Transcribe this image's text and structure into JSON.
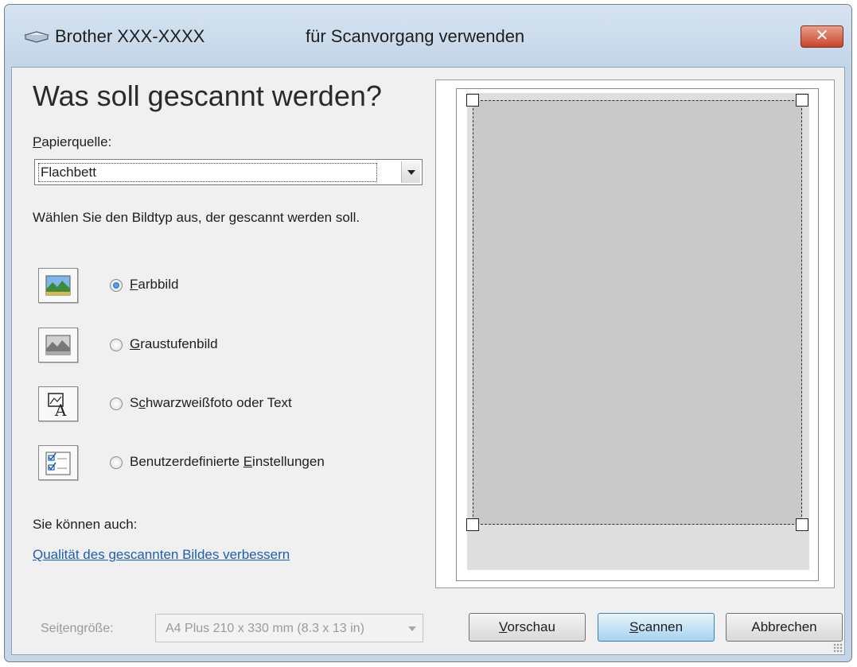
{
  "window": {
    "title_app": "Brother XXX-XXXX",
    "title_rest": "für Scanvorgang verwenden",
    "close_glyph": "✕"
  },
  "main": {
    "heading": "Was soll gescannt werden?",
    "paper_source_label_u": "P",
    "paper_source_label_rest": "apierquelle:",
    "paper_source_value": "Flachbett",
    "description": "Wählen Sie den Bildtyp aus, der gescannt werden soll.",
    "image_types": [
      {
        "label_pre": "",
        "label_u": "F",
        "label_post": "arbbild",
        "checked": true,
        "icon": "color-photo-icon"
      },
      {
        "label_pre": "",
        "label_u": "G",
        "label_post": "raustufenbild",
        "checked": false,
        "icon": "grayscale-photo-icon"
      },
      {
        "label_pre": "S",
        "label_u": "c",
        "label_post": "hwarzweißfoto oder Text",
        "checked": false,
        "icon": "bw-text-icon"
      },
      {
        "label_pre": "Benutzerdefinierte ",
        "label_u": "E",
        "label_post": "instellungen",
        "checked": false,
        "icon": "custom-settings-icon"
      }
    ],
    "also_label": "Sie können auch:",
    "improve_link": "Qualität des gescannten Bildes verbessern"
  },
  "footer": {
    "page_size_label_pre": "Sei",
    "page_size_label_u": "t",
    "page_size_label_post": "engröße:",
    "page_size_value": "A4 Plus 210 x 330 mm (8.3 x 13 in)",
    "preview_u": "V",
    "preview_rest": "orschau",
    "scan_u": "S",
    "scan_rest": "cannen",
    "cancel_label": "Abbrechen"
  },
  "colors": {
    "accent": "#1a5fb4",
    "preview_region": "#c9c9c9",
    "close_button": "#c9432a"
  }
}
